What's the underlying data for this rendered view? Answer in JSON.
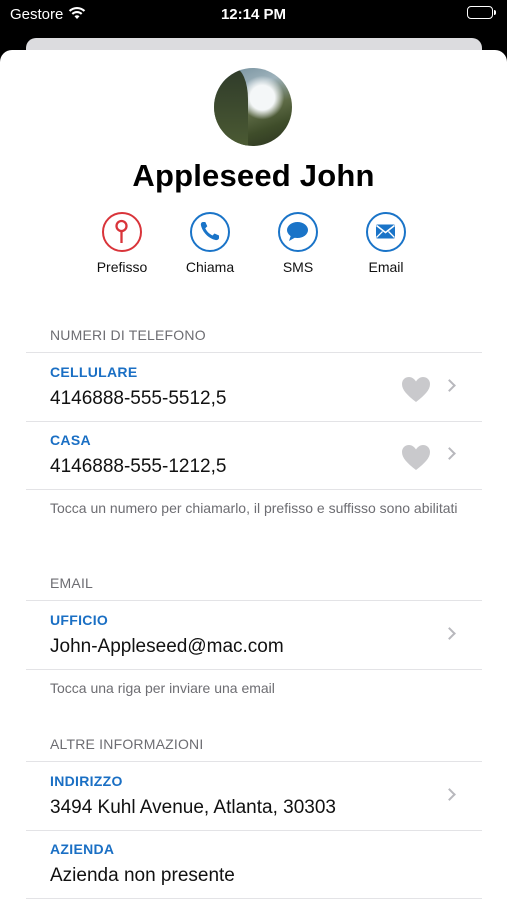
{
  "status_bar": {
    "carrier": "Gestore",
    "time": "12:14 PM"
  },
  "contact": {
    "name": "Appleseed John"
  },
  "actions": [
    {
      "label": "Prefisso",
      "icon": "pin-icon",
      "color": "#d9343a"
    },
    {
      "label": "Chiama",
      "icon": "phone-icon",
      "color": "#1a74c8"
    },
    {
      "label": "SMS",
      "icon": "message-icon",
      "color": "#1a74c8"
    },
    {
      "label": "Email",
      "icon": "envelope-icon",
      "color": "#1a74c8"
    }
  ],
  "phone_section": {
    "header": "NUMERI DI TELEFONO",
    "rows": [
      {
        "label": "CELLULARE",
        "value": "4146888-555-5512,5"
      },
      {
        "label": "CASA",
        "value": "4146888-555-1212,5"
      }
    ],
    "footer": "Tocca un numero per chiamarlo, il prefisso e suffisso sono abilitati"
  },
  "email_section": {
    "header": "EMAIL",
    "rows": [
      {
        "label": "UFFICIO",
        "value": "John-Appleseed@mac.com"
      }
    ],
    "footer": "Tocca una riga per inviare una email"
  },
  "info_section": {
    "header": "ALTRE INFORMAZIONI",
    "rows": [
      {
        "label": "INDIRIZZO",
        "value": "3494 Kuhl Avenue, Atlanta, 30303"
      },
      {
        "label": "AZIENDA",
        "value": "Azienda non presente"
      }
    ]
  },
  "colors": {
    "accent": "#1a6fc4",
    "prefix_red": "#d9343a"
  }
}
